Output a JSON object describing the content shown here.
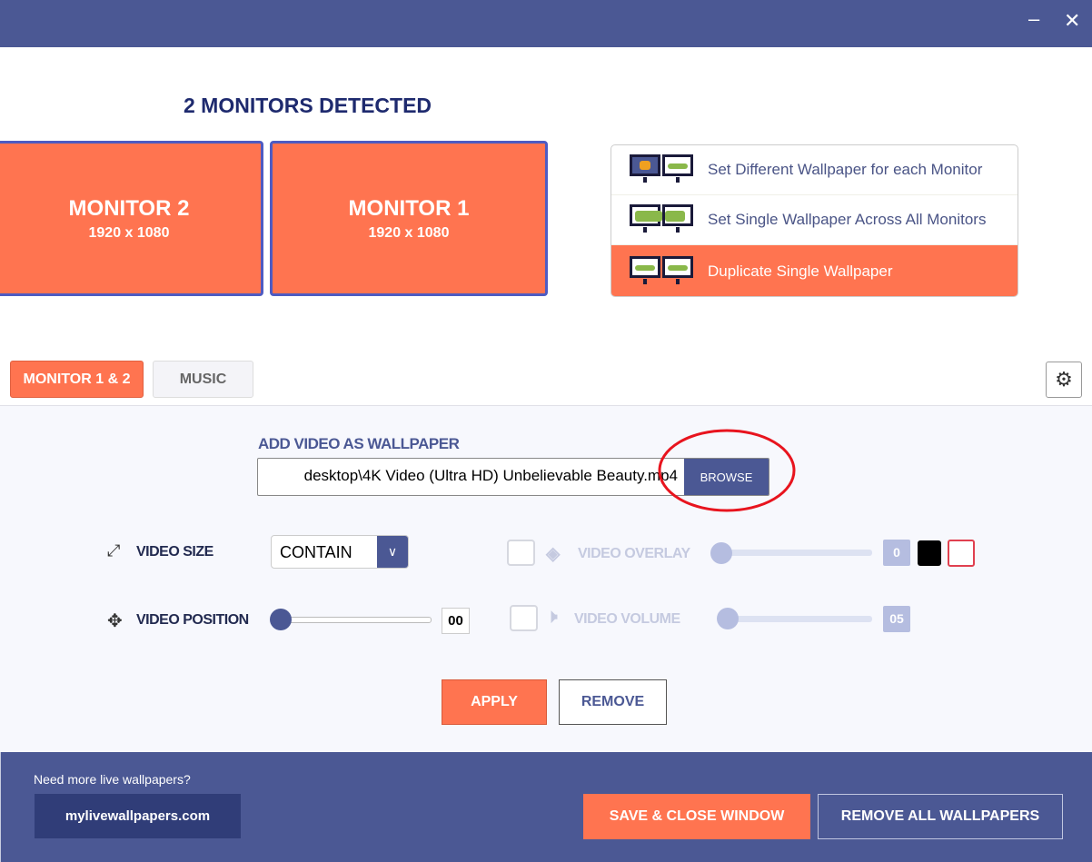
{
  "window": {
    "minimize_icon": "minimize-icon",
    "close_icon": "close-icon",
    "minimize": "–",
    "close": "✕"
  },
  "heading": "2 MONITORS DETECTED",
  "monitors": [
    {
      "name": "MONITOR 2",
      "resolution": "1920 x 1080"
    },
    {
      "name": "MONITOR 1",
      "resolution": "1920 x 1080"
    }
  ],
  "modes": [
    {
      "label": "Set Different Wallpaper for each Monitor",
      "selected": false
    },
    {
      "label": "Set Single Wallpaper Across All Monitors",
      "selected": false
    },
    {
      "label": "Duplicate Single Wallpaper",
      "selected": true
    }
  ],
  "tabs": [
    {
      "label": "MONITOR 1 & 2",
      "active": true
    },
    {
      "label": "MUSIC",
      "active": false
    }
  ],
  "settings_icon": "gears-icon",
  "video": {
    "section_title": "ADD VIDEO AS WALLPAPER",
    "path_value": "desktop\\4K Video (Ultra HD) Unbelievable Beauty.mp4",
    "browse_label": "BROWSE",
    "size_label": "VIDEO SIZE",
    "size_value": "CONTAIN",
    "position_label": "VIDEO POSITION",
    "position_value": "00",
    "position_level": 0,
    "overlay_label": "VIDEO OVERLAY",
    "overlay_value": "0",
    "overlay_level": 0,
    "volume_label": "VIDEO VOLUME",
    "volume_value": "05",
    "volume_level": 5,
    "apply_label": "APPLY",
    "remove_label": "REMOVE"
  },
  "footer": {
    "prompt": "Need more live wallpapers?",
    "link": "mylivewallpapers.com",
    "save_label": "SAVE & CLOSE WINDOW",
    "remove_all_label": "REMOVE ALL WALLPAPERS"
  },
  "colors": {
    "accent": "#ff7450",
    "primary": "#4b5894",
    "annotation": "#e8141e"
  }
}
